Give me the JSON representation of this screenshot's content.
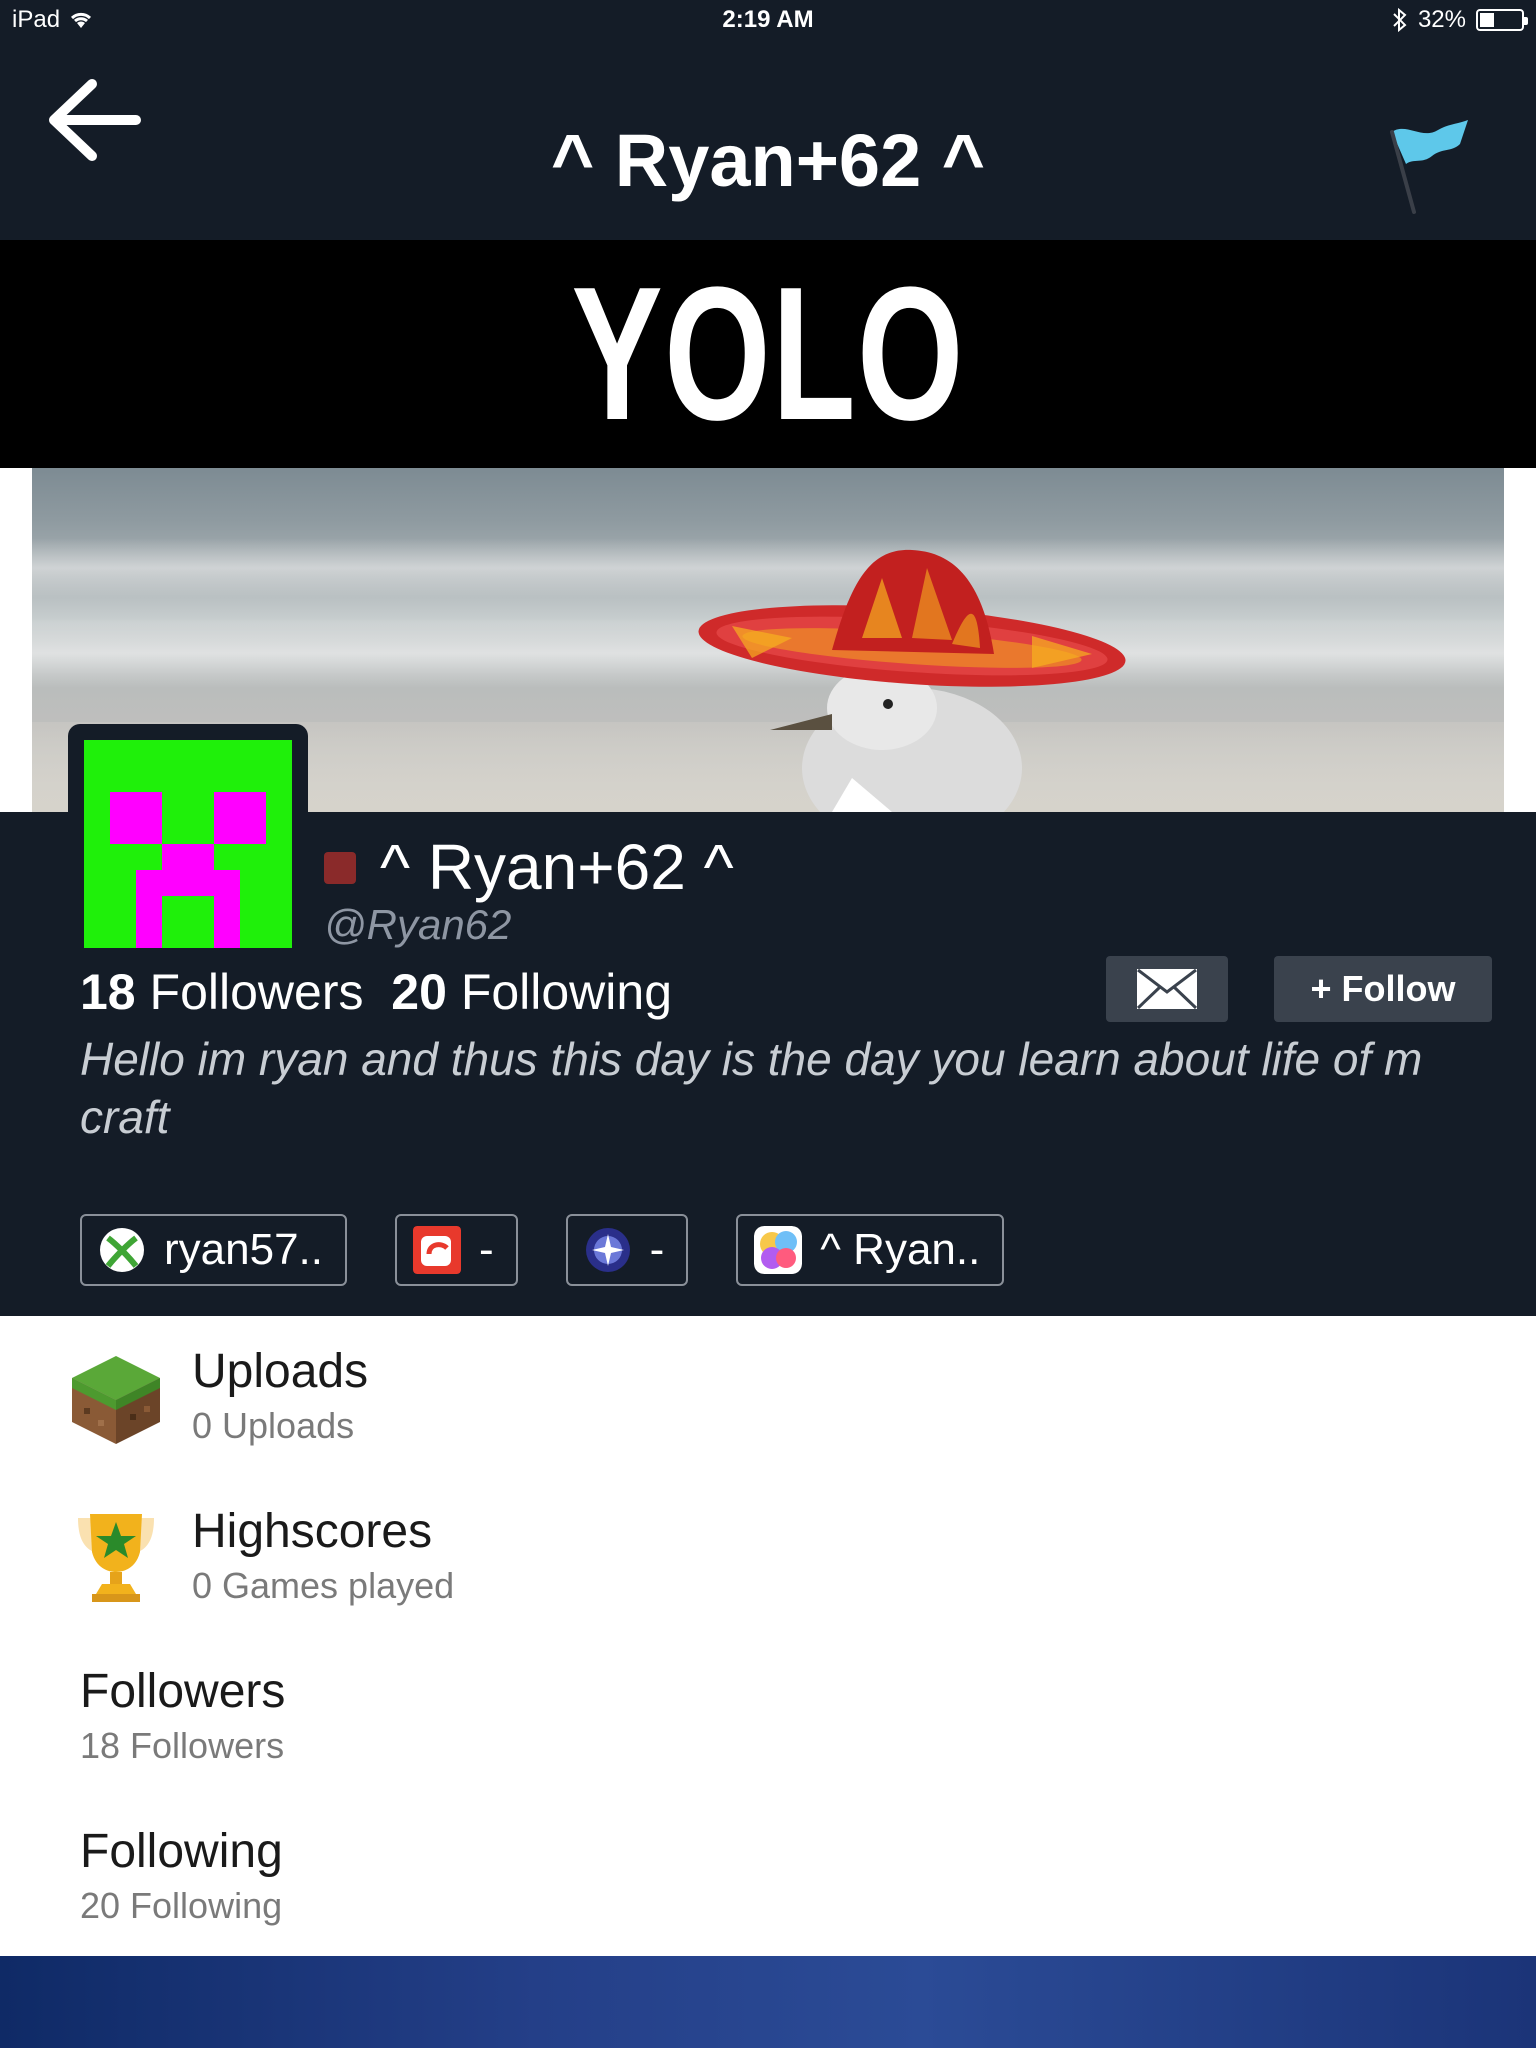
{
  "status_bar": {
    "device": "iPad",
    "time": "2:19 AM",
    "battery_text": "32%",
    "battery_level": 0.32
  },
  "nav": {
    "title": "^ Ryan+62 ^",
    "back_icon": "back-arrow-icon",
    "flag_icon": "flag-icon"
  },
  "banner": {
    "text": "YOLO"
  },
  "profile": {
    "display_name": "^ Ryan+62 ^",
    "handle": "@Ryan62",
    "followers_count": "18",
    "followers_label": "Followers",
    "following_count": "20",
    "following_label": "Following",
    "message_icon": "envelope-icon",
    "follow_label": "+ Follow",
    "bio": "Hello im ryan and thus this day is the day you learn about life of m craft",
    "status_color": "#8a2a2a"
  },
  "gamer_ids": [
    {
      "icon": "xbox-icon",
      "value": "ryan57.."
    },
    {
      "icon": "origin-icon",
      "value": "-"
    },
    {
      "icon": "playstation-icon",
      "value": "-"
    },
    {
      "icon": "game-center-icon",
      "value": "^ Ryan.."
    }
  ],
  "list": [
    {
      "icon": "grass-block-icon",
      "title": "Uploads",
      "subtitle": "0 Uploads"
    },
    {
      "icon": "trophy-icon",
      "title": "Highscores",
      "subtitle": "0 Games played"
    },
    {
      "title": "Followers",
      "subtitle": "18 Followers"
    },
    {
      "title": "Following",
      "subtitle": "20 Following"
    }
  ],
  "colors": {
    "background": "#141c27",
    "avatar_green": "#1ff00a",
    "avatar_pink": "#ff00ff",
    "button_bg": "#3a424d"
  }
}
